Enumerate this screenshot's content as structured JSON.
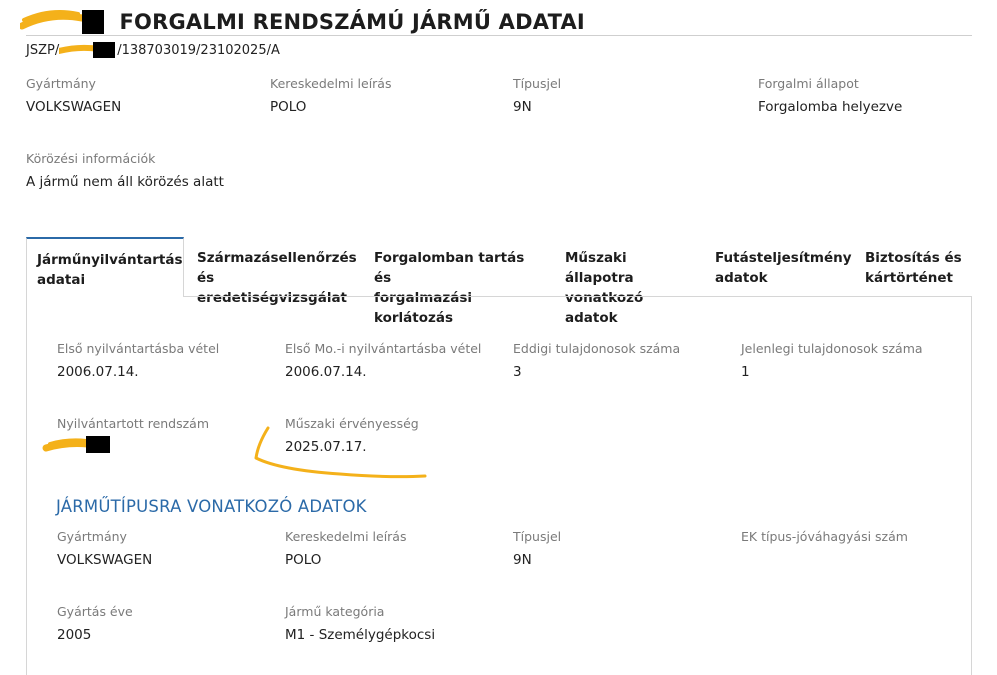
{
  "header": {
    "title": "FORGALMI RENDSZÁMÚ JÁRMŰ ADATAI",
    "subtitle_prefix": "JSZP/",
    "subtitle_suffix": "/138703019/23102025/A"
  },
  "summary": {
    "gyartmany": {
      "label": "Gyártmány",
      "value": "VOLKSWAGEN"
    },
    "kereskedelmi": {
      "label": "Kereskedelmi leírás",
      "value": "POLO"
    },
    "tipusjel": {
      "label": "Típusjel",
      "value": "9N"
    },
    "forgalmi": {
      "label": "Forgalmi állapot",
      "value": "Forgalomba helyezve"
    },
    "korozes": {
      "label": "Körözési információk",
      "value": "A jármű nem áll körözés alatt"
    }
  },
  "tabs": [
    {
      "line1": "Járműnyilvántartás",
      "line2": "adatai"
    },
    {
      "line1": "Származásellenőrzés",
      "line2": "és eredetiségvizsgálat"
    },
    {
      "line1": "Forgalomban tartás és",
      "line2": "forgalmazási korlátozás"
    },
    {
      "line1": "Műszaki állapotra",
      "line2": "vonatkozó adatok"
    },
    {
      "line1": "Futásteljesítmény",
      "line2": "adatok"
    },
    {
      "line1": "Biztosítás és",
      "line2": "kártörténet"
    }
  ],
  "registry": {
    "elso_nyilv": {
      "label": "Első nyilvántartásba vétel",
      "value": "2006.07.14."
    },
    "elso_mo": {
      "label": "Első Mo.-i nyilvántartásba vétel",
      "value": "2006.07.14."
    },
    "eddigi_tul": {
      "label": "Eddigi tulajdonosok száma",
      "value": "3"
    },
    "jelenlegi_tul": {
      "label": "Jelenlegi tulajdonosok száma",
      "value": "1"
    },
    "rendszam": {
      "label": "Nyilvántartott rendszám"
    },
    "muszaki": {
      "label": "Műszaki érvényesség",
      "value": "2025.07.17."
    }
  },
  "type_section": {
    "title": "JÁRMŰTÍPUSRA VONATKOZÓ ADATOK",
    "gyartmany": {
      "label": "Gyártmány",
      "value": "VOLKSWAGEN"
    },
    "kereskedelmi": {
      "label": "Kereskedelmi leírás",
      "value": "POLO"
    },
    "tipusjel": {
      "label": "Típusjel",
      "value": "9N"
    },
    "ek": {
      "label": "EK típus-jóváhagyási szám"
    },
    "gyartas_eve": {
      "label": "Gyártás éve",
      "value": "2005"
    },
    "kategoria": {
      "label": "Jármű kategória",
      "value": "M1 - Személygépkocsi"
    }
  },
  "colors": {
    "accent": "#2b6aa8",
    "annotation": "#f4b11a",
    "redaction": "#000000"
  }
}
